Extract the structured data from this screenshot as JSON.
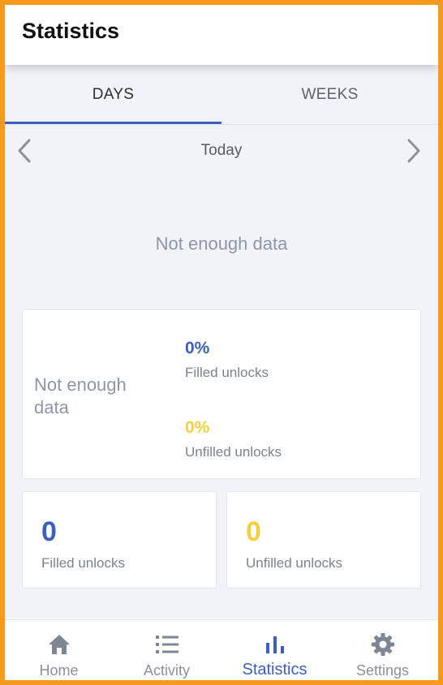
{
  "app_bar": {
    "title": "Statistics"
  },
  "tabs": [
    {
      "label": "DAYS",
      "selected": true
    },
    {
      "label": "WEEKS",
      "selected": false
    }
  ],
  "date_nav": {
    "label": "Today",
    "prev_icon": "chevron-left-icon",
    "next_icon": "chevron-right-icon"
  },
  "chart": {
    "empty_message": "Not enough data"
  },
  "summary_card": {
    "empty_message": "Not enough data",
    "filled": {
      "percent": "0%",
      "label": "Filled unlocks",
      "color": "#3a5fc0"
    },
    "unfilled": {
      "percent": "0%",
      "label": "Unfilled unlocks",
      "color": "#f5cf3e"
    }
  },
  "count_cards": [
    {
      "value": "0",
      "label": "Filled unlocks",
      "color": "#3a5fc0"
    },
    {
      "value": "0",
      "label": "Unfilled unlocks",
      "color": "#f5cf3e"
    }
  ],
  "bottom_nav": [
    {
      "label": "Home",
      "icon": "home-icon",
      "active": false
    },
    {
      "label": "Activity",
      "icon": "list-icon",
      "active": false
    },
    {
      "label": "Statistics",
      "icon": "bar-chart-icon",
      "active": true
    },
    {
      "label": "Settings",
      "icon": "gear-icon",
      "active": false
    }
  ],
  "colors": {
    "accent": "#3a5fc0",
    "highlight": "#f5cf3e",
    "frame": "#f59a1c",
    "background": "#f1f3f8"
  }
}
